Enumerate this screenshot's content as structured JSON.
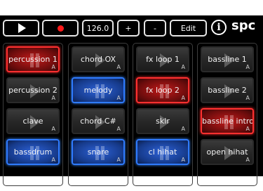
{
  "toolbar": {
    "tempo": "126.0",
    "plus_label": "+",
    "minus_label": "-",
    "edit_label": "Edit",
    "info_label": "i",
    "logo": "spc"
  },
  "colors": {
    "active_red": "#ff3030",
    "active_blue": "#2f7bff",
    "record": "#ff1a1a"
  },
  "columns": [
    {
      "pads": [
        {
          "label": "percussion 1",
          "letter": "A",
          "state": "playing",
          "color": "red"
        },
        {
          "label": "percussion 2",
          "letter": "A",
          "state": "stopped",
          "color": "none"
        },
        {
          "label": "clave",
          "letter": "A",
          "state": "stopped",
          "color": "none"
        },
        {
          "label": "bassdrum",
          "letter": "A",
          "state": "playing",
          "color": "blue"
        }
      ]
    },
    {
      "pads": [
        {
          "label": "chord OX",
          "letter": "A",
          "state": "stopped",
          "color": "none"
        },
        {
          "label": "melody",
          "letter": "A",
          "state": "playing",
          "color": "blue"
        },
        {
          "label": "chord C#",
          "letter": "A",
          "state": "stopped",
          "color": "none"
        },
        {
          "label": "snare",
          "letter": "A",
          "state": "playing",
          "color": "blue"
        }
      ]
    },
    {
      "pads": [
        {
          "label": "fx loop 1",
          "letter": "A",
          "state": "stopped",
          "color": "none"
        },
        {
          "label": "fx loop 2",
          "letter": "A",
          "state": "playing",
          "color": "red"
        },
        {
          "label": "sklr",
          "letter": "A",
          "state": "stopped",
          "color": "none"
        },
        {
          "label": "cl hihat",
          "letter": "A",
          "state": "playing",
          "color": "blue"
        }
      ]
    },
    {
      "pads": [
        {
          "label": "bassline 1",
          "letter": "A",
          "state": "stopped",
          "color": "none"
        },
        {
          "label": "bassline 2",
          "letter": "A",
          "state": "stopped",
          "color": "none"
        },
        {
          "label": "bassline intro",
          "letter": "A",
          "state": "playing",
          "color": "red"
        },
        {
          "label": "open hihat",
          "letter": "A",
          "state": "stopped",
          "color": "none"
        }
      ]
    }
  ]
}
